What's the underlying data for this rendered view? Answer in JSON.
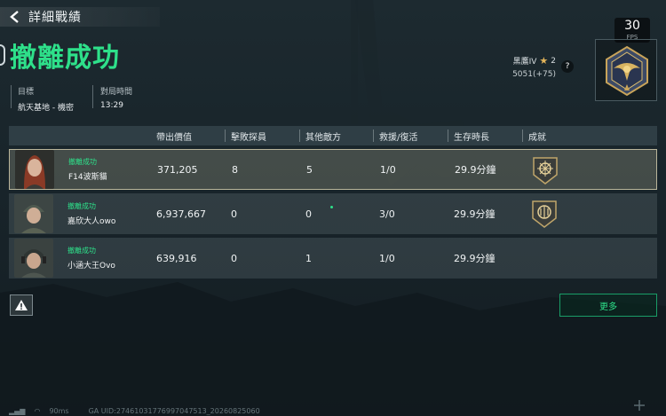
{
  "header": {
    "back_label": "詳細戰績"
  },
  "result": {
    "title": "撤離成功"
  },
  "meta": {
    "map_label": "目標",
    "map_value": "航天基地 - 機密",
    "time_label": "對局時間",
    "time_value": "13:29"
  },
  "fps": {
    "value": "30",
    "label": "FPS"
  },
  "rank": {
    "name": "黑鷹IV",
    "stars": "2",
    "score": "5051(+75)",
    "help": "?"
  },
  "table": {
    "headers": [
      "帶出價值",
      "擊敗探員",
      "其他敵方",
      "救援/復活",
      "生存時長",
      "成就"
    ],
    "rows": [
      {
        "status": "撤離成功",
        "name": "F14波斯貓",
        "value": "371,205",
        "kills": "8",
        "other": "5",
        "rescue": "1/0",
        "survival": "29.9分鐘"
      },
      {
        "status": "撤離成功",
        "name": "嘉欣大人owo",
        "value": "6,937,667",
        "kills": "0",
        "other": "0",
        "rescue": "3/0",
        "survival": "29.9分鐘"
      },
      {
        "status": "撤離成功",
        "name": "小涵大王Ovo",
        "value": "639,916",
        "kills": "0",
        "other": "1",
        "rescue": "1/0",
        "survival": "29.9分鐘"
      }
    ]
  },
  "buttons": {
    "more_label": "更多"
  },
  "footer": {
    "ping": "90ms",
    "uid": "GA UID:27461031776997047513_20260825060"
  },
  "colors": {
    "accent": "#2ee08a",
    "highlight_border": "#b9b59b"
  }
}
